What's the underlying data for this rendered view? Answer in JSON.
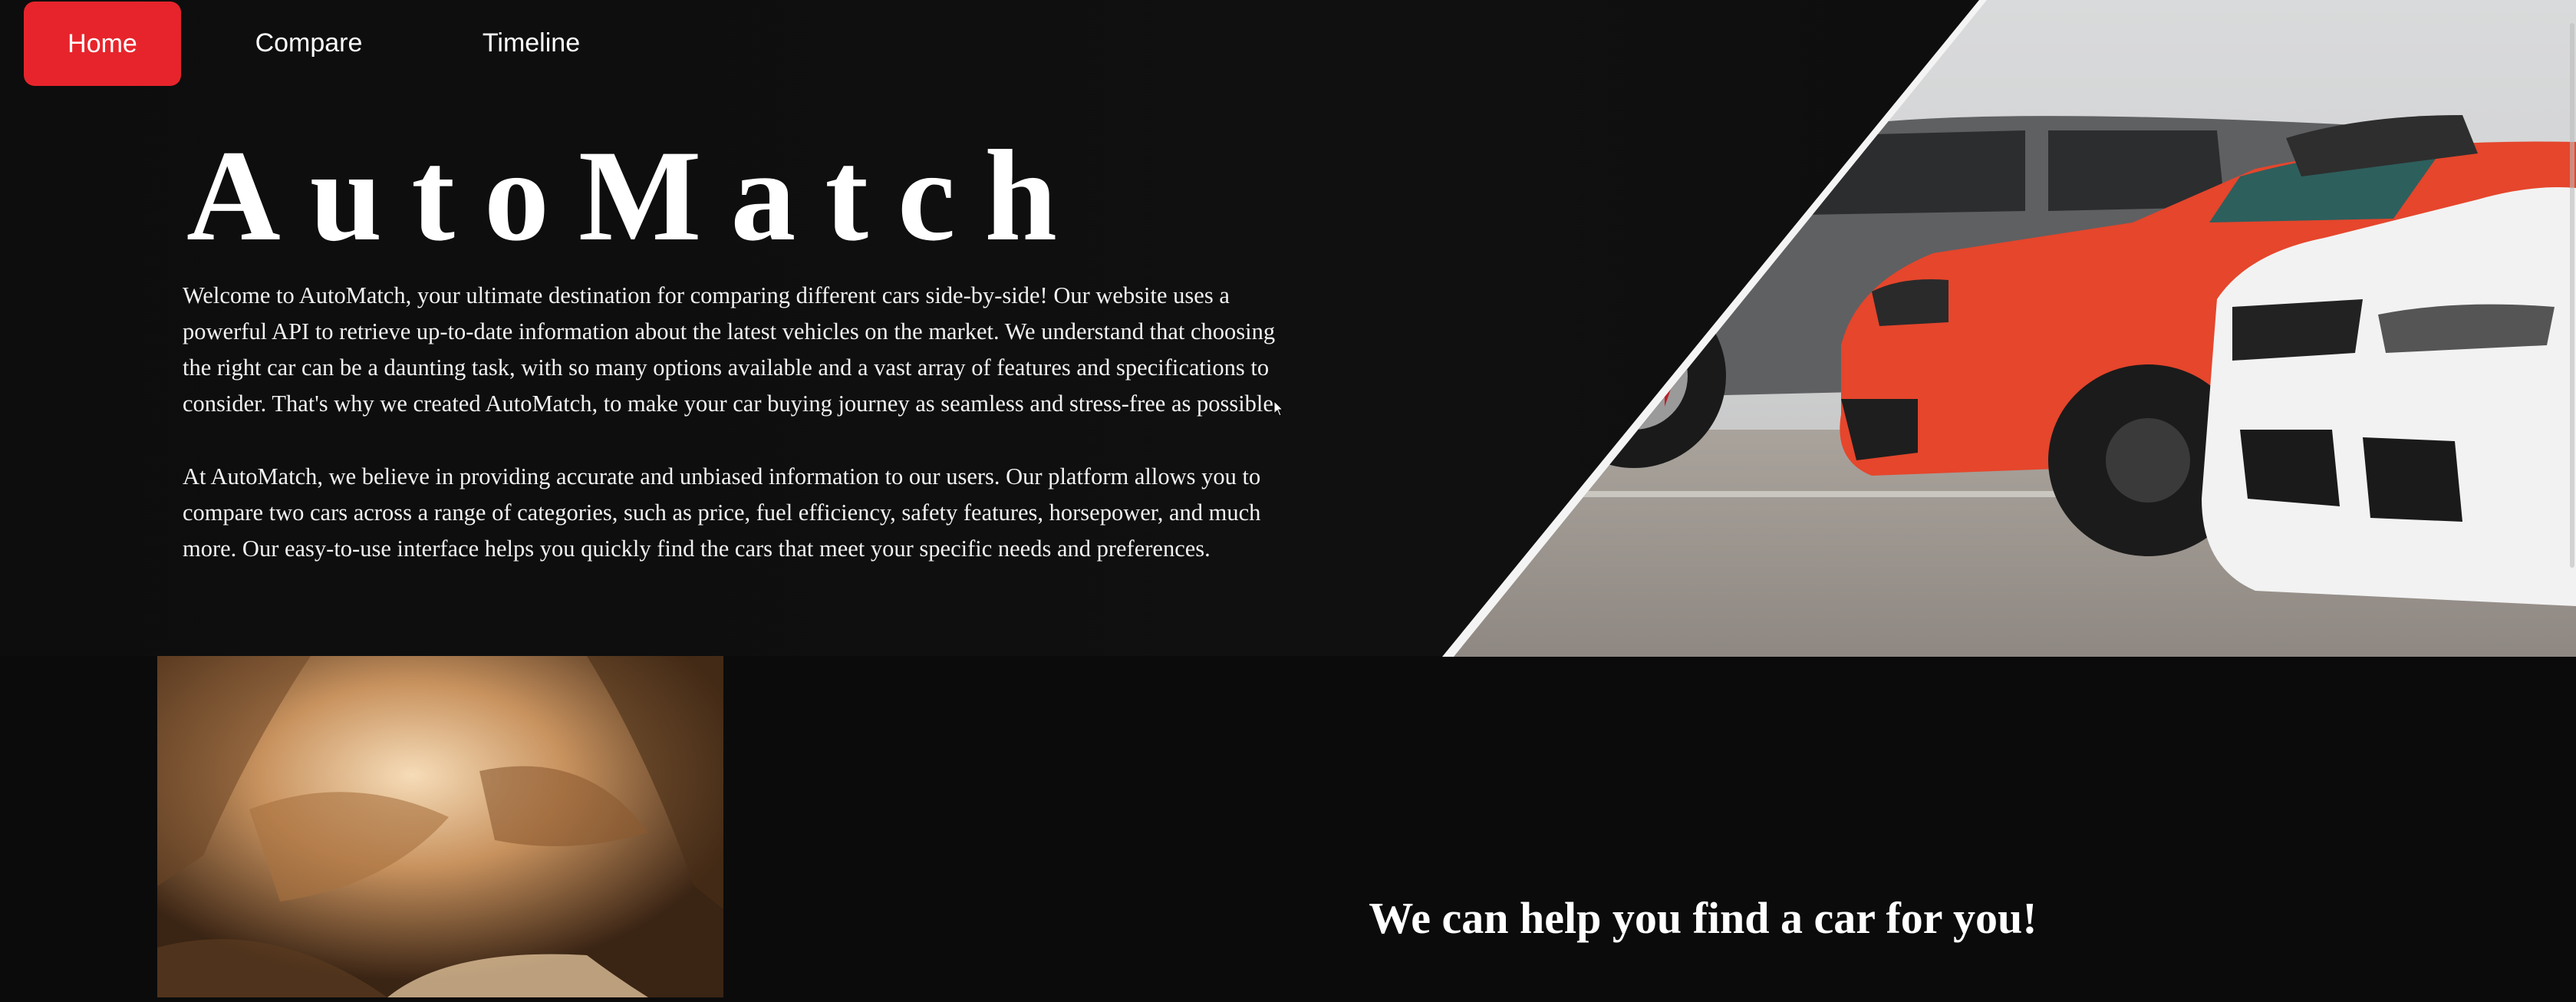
{
  "nav": {
    "items": [
      {
        "label": "Home",
        "active": true
      },
      {
        "label": "Compare",
        "active": false
      },
      {
        "label": "Timeline",
        "active": false
      }
    ],
    "accent": "#e7242b"
  },
  "hero": {
    "title": "AutoMatch",
    "paragraph_1_lines": [
      "Welcome to AutoMatch, your ultimate destination for comparing different cars side-by-side! Our website uses a",
      "powerful API to retrieve up-to-date information about the latest vehicles on the market. We understand that choosing",
      "the right car can be a daunting task, with so many options available and a vast array of features and specifications to",
      "consider. That's why we created AutoMatch, to make your car buying journey as seamless and stress-free as possible."
    ],
    "paragraph_2_lines": [
      "At AutoMatch, we believe in providing accurate and unbiased information to our users. Our platform allows you to",
      "compare two cars across a range of categories, such as price, fuel efficiency, safety features, horsepower, and much",
      "more. Our easy-to-use interface helps you quickly find the cars that meet your specific needs and preferences."
    ],
    "image": "three-cars-photo"
  },
  "section": {
    "image": "autumn-forest-road-photo",
    "heading": "We can help you find a car for you!"
  },
  "colors": {
    "background": "#0b0b0b",
    "text": "#ffffff"
  }
}
